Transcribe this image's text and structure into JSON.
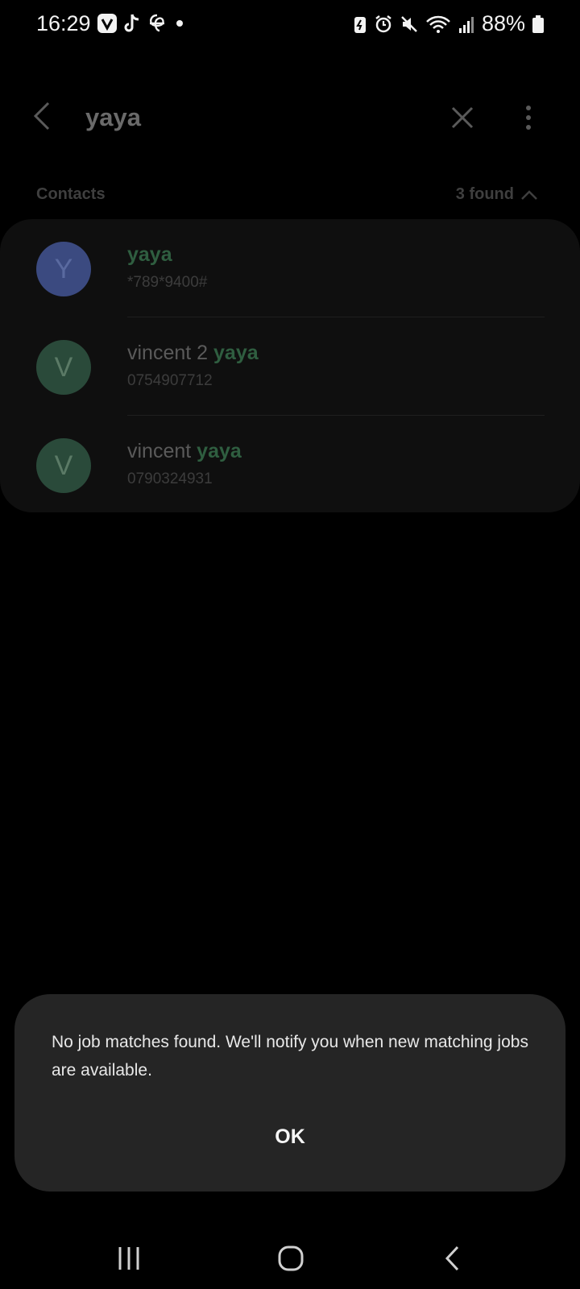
{
  "status_bar": {
    "time": "16:29",
    "battery": "88%",
    "left_icons": [
      "vivaldi-icon",
      "tiktok-icon",
      "threads-icon",
      "dot-icon"
    ],
    "right_icons": [
      "battery-saver-icon",
      "alarm-icon",
      "mute-icon",
      "wifi-icon",
      "signal-icon",
      "battery-icon"
    ]
  },
  "toolbar": {
    "search_query": "yaya"
  },
  "contacts_section": {
    "label": "Contacts",
    "found_count": "3 found"
  },
  "contacts": [
    {
      "initial": "Y",
      "name_prefix": "",
      "name_match": "yaya",
      "number": "*789*9400#",
      "avatar_color": "#3b4a80"
    },
    {
      "initial": "V",
      "name_prefix": "vincent 2 ",
      "name_match": "yaya",
      "number": "0754907712",
      "avatar_color": "#2a4a3a"
    },
    {
      "initial": "V",
      "name_prefix": "vincent ",
      "name_match": "yaya",
      "number": "0790324931",
      "avatar_color": "#2a4a3a"
    }
  ],
  "dialog": {
    "message": "No job matches found. We'll notify you when new matching jobs are available.",
    "ok_label": "OK"
  },
  "colors": {
    "highlight": "#2f5e40",
    "dialog_bg": "#252525",
    "background": "#000000"
  }
}
